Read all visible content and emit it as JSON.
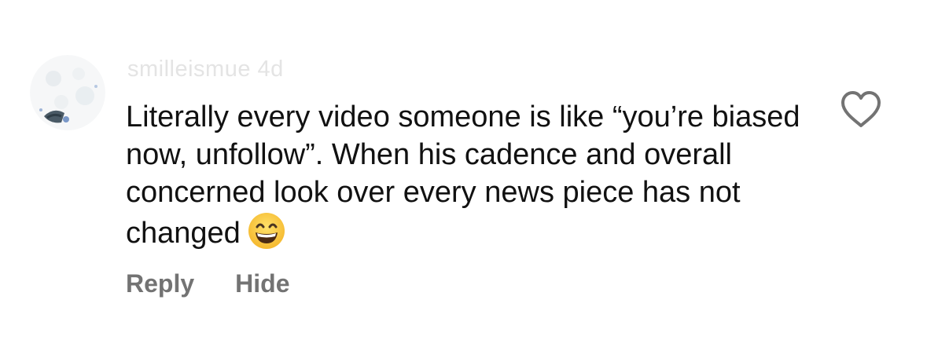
{
  "comment": {
    "username": "smilleismue 4d",
    "text": "Literally every video someone is like “you’re biased now, unfollow”. When his cadence and overall concerned look over every news piece has not changed",
    "emoji": "grinning-face-with-smiling-eyes",
    "actions": {
      "reply_label": "Reply",
      "hide_label": "Hide"
    },
    "like_icon": "heart-outline-icon"
  },
  "colors": {
    "text": "#111111",
    "username": "#e4e4e4",
    "secondary": "#737373",
    "background": "#ffffff"
  }
}
